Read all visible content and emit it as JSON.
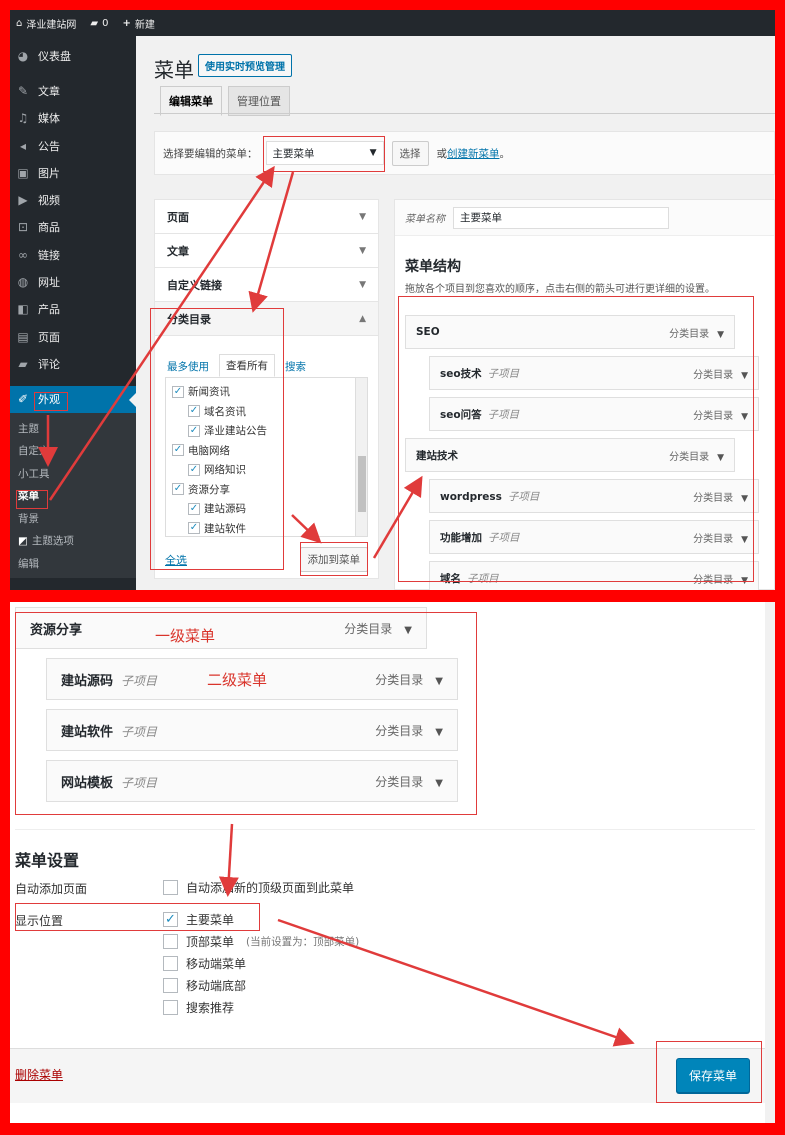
{
  "adminbar": {
    "site_name": "泽业建站网",
    "comments_count": "0",
    "new_label": "新建"
  },
  "sidebar": {
    "items": [
      {
        "label": "仪表盘",
        "icon": "dashboard-icon"
      },
      {
        "label": "文章",
        "icon": "pin-icon"
      },
      {
        "label": "媒体",
        "icon": "media-icon"
      },
      {
        "label": "公告",
        "icon": "megaphone-icon"
      },
      {
        "label": "图片",
        "icon": "image-icon"
      },
      {
        "label": "视频",
        "icon": "video-icon"
      },
      {
        "label": "商品",
        "icon": "cart-icon"
      },
      {
        "label": "链接",
        "icon": "link-icon"
      },
      {
        "label": "网址",
        "icon": "globe-icon"
      },
      {
        "label": "产品",
        "icon": "product-icon"
      },
      {
        "label": "页面",
        "icon": "page-icon"
      },
      {
        "label": "评论",
        "icon": "comment-icon"
      }
    ],
    "appearance": "外观",
    "sub_items": [
      "主题",
      "自定义",
      "小工具",
      "菜单",
      "背景",
      "主题选项",
      "编辑"
    ]
  },
  "page": {
    "title": "菜单",
    "live_preview": "使用实时预览管理",
    "tabs": [
      "编辑菜单",
      "管理位置"
    ]
  },
  "manage": {
    "label": "选择要编辑的菜单：",
    "selected": "主要菜单",
    "select_btn": "选择",
    "or_text": "或",
    "create_link": "创建新菜单",
    "period": "。"
  },
  "accordion": {
    "sections": [
      "页面",
      "文章",
      "自定义链接",
      "分类目录"
    ],
    "inner_tabs": [
      "最多使用",
      "查看所有",
      "搜索"
    ],
    "tree": [
      {
        "label": "新闻资讯",
        "child": false
      },
      {
        "label": "域名资讯",
        "child": true
      },
      {
        "label": "泽业建站公告",
        "child": true
      },
      {
        "label": "电脑网络",
        "child": false
      },
      {
        "label": "网络知识",
        "child": true
      },
      {
        "label": "资源分享",
        "child": false
      },
      {
        "label": "建站源码",
        "child": true
      },
      {
        "label": "建站软件",
        "child": true
      }
    ],
    "select_all": "全选",
    "add_to_menu": "添加到菜单"
  },
  "menu_edit": {
    "name_label": "菜单名称",
    "name_value": "主要菜单",
    "structure_title": "菜单结构",
    "structure_desc": "拖放各个项目到您喜欢的顺序，点击右侧的箭头可进行更详细的设置。",
    "type_label": "分类目录",
    "sub_label": "子项目",
    "items": [
      {
        "title": "SEO",
        "sub": ""
      },
      {
        "title": "seo技术",
        "sub": "子项目"
      },
      {
        "title": "seo问答",
        "sub": "子项目"
      },
      {
        "title": "建站技术",
        "sub": ""
      },
      {
        "title": "wordpress",
        "sub": "子项目"
      },
      {
        "title": "功能增加",
        "sub": "子项目"
      },
      {
        "title": "域名",
        "sub": "子项目"
      }
    ]
  },
  "bottom": {
    "items": [
      {
        "title": "资源分享",
        "sub": ""
      },
      {
        "title": "建站源码",
        "sub": "子项目"
      },
      {
        "title": "建站软件",
        "sub": "子项目"
      },
      {
        "title": "网站模板",
        "sub": "子项目"
      }
    ],
    "type_label": "分类目录",
    "annot_level1": "一级菜单",
    "annot_level2": "二级菜单",
    "settings_title": "菜单设置",
    "auto_add_label": "自动添加页面",
    "auto_add_option": "自动添加新的顶级页面到此菜单",
    "display_label": "显示位置",
    "locations": [
      {
        "label": "主要菜单",
        "checked": true,
        "hint": ""
      },
      {
        "label": "顶部菜单",
        "checked": false,
        "hint": "(当前设置为：顶部菜单)"
      },
      {
        "label": "移动端菜单",
        "checked": false,
        "hint": ""
      },
      {
        "label": "移动端底部",
        "checked": false,
        "hint": ""
      },
      {
        "label": "搜索推荐",
        "checked": false,
        "hint": ""
      }
    ],
    "delete_menu": "删除菜单",
    "save_menu": "保存菜单"
  },
  "colors": {
    "frame": "#ff0000",
    "admin_dark": "#23282d",
    "accent": "#0073aa",
    "annotation": "#e03b3b"
  }
}
